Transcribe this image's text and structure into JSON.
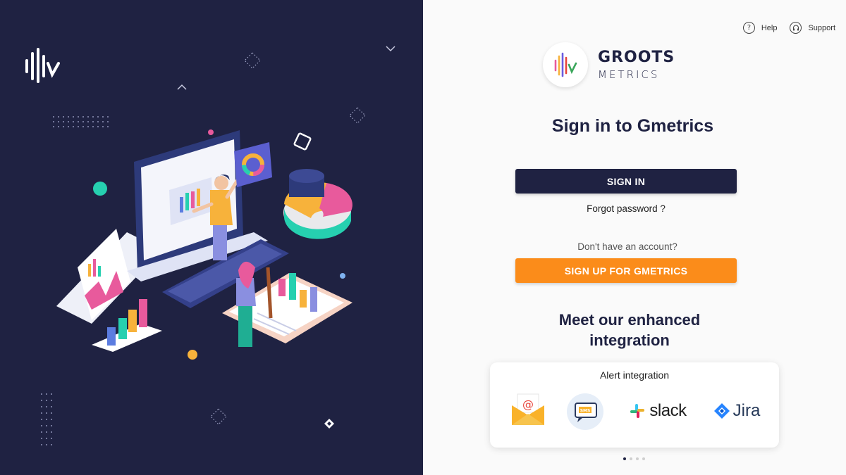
{
  "header": {
    "help_label": "Help",
    "help_icon": "question-circle-icon",
    "support_label": "Support",
    "support_icon": "headset-icon"
  },
  "logo": {
    "line1": "GROOTS",
    "line2": "METRICS"
  },
  "signin": {
    "title": "Sign in to Gmetrics",
    "signin_button": "SIGN IN",
    "forgot_link": "Forgot password ?",
    "no_account_text": "Don't have an account?",
    "signup_button": "SIGN UP FOR GMETRICS"
  },
  "integration": {
    "heading_line1": "Meet our enhanced",
    "heading_line2": "integration",
    "card_title": "Alert integration",
    "items": [
      {
        "name": "email",
        "icon": "email-icon"
      },
      {
        "name": "sms",
        "icon": "sms-icon",
        "badge_text": "SMS"
      },
      {
        "name": "slack",
        "icon": "slack-icon",
        "label": "slack"
      },
      {
        "name": "jira",
        "icon": "jira-icon",
        "label": "Jira"
      }
    ],
    "carousel_pages": 4,
    "carousel_active": 1
  },
  "colors": {
    "primary": "#1f2242",
    "accent": "#fb8c1a",
    "background": "#fafafa"
  }
}
